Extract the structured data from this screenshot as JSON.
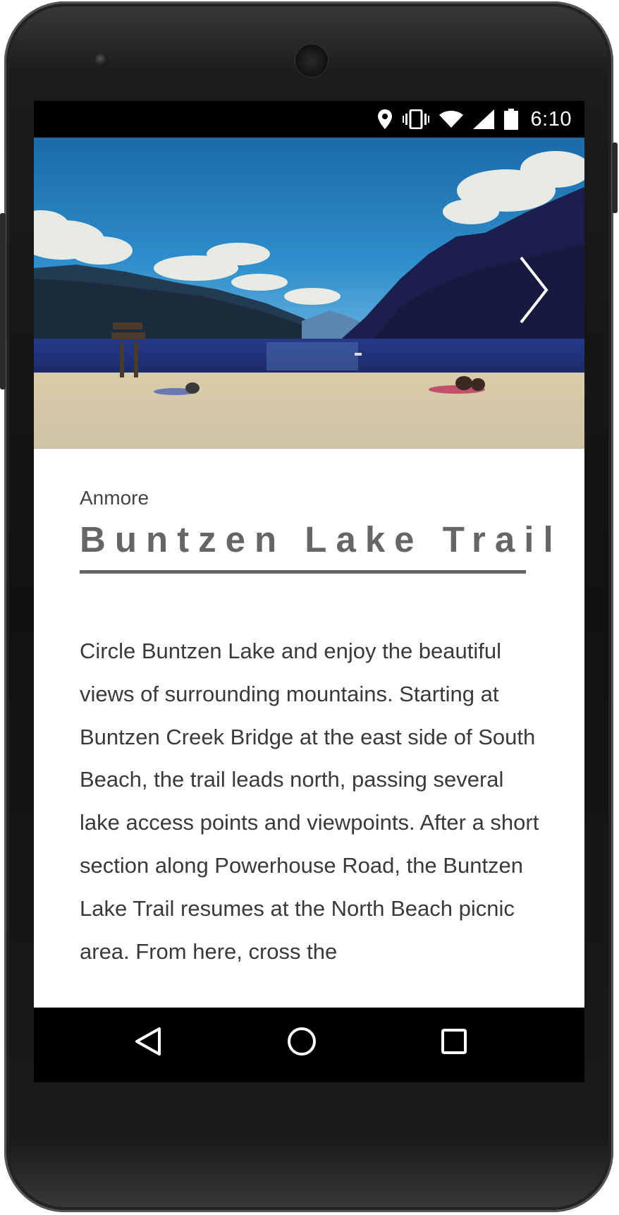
{
  "status_bar": {
    "time": "6:10",
    "icons": [
      "location-icon",
      "vibrate-icon",
      "wifi-icon",
      "cell-signal-icon",
      "battery-icon"
    ]
  },
  "hero": {
    "image_description_icon": "lake-landscape-photo",
    "next_icon": "chevron-right-icon"
  },
  "trail": {
    "region": "Anmore",
    "title": "Buntzen Lake Trail",
    "description": "Circle Buntzen Lake and enjoy the beautiful views of surrounding mountains. Starting at Buntzen Creek Bridge at the east side of South Beach, the trail leads north, passing several lake access points and viewpoints. After a short section along Powerhouse Road, the Buntzen Lake Trail resumes at the North Beach picnic area. From here, cross the"
  },
  "nav_bar": {
    "back_icon": "back-triangle-icon",
    "home_icon": "home-circle-icon",
    "recents_icon": "recents-square-icon"
  },
  "colors": {
    "title": "#666666",
    "body_text": "#3a3a3a",
    "sky": "#1d78b8",
    "mountains": "#1b1d4a",
    "sand": "#d9cfb4"
  }
}
